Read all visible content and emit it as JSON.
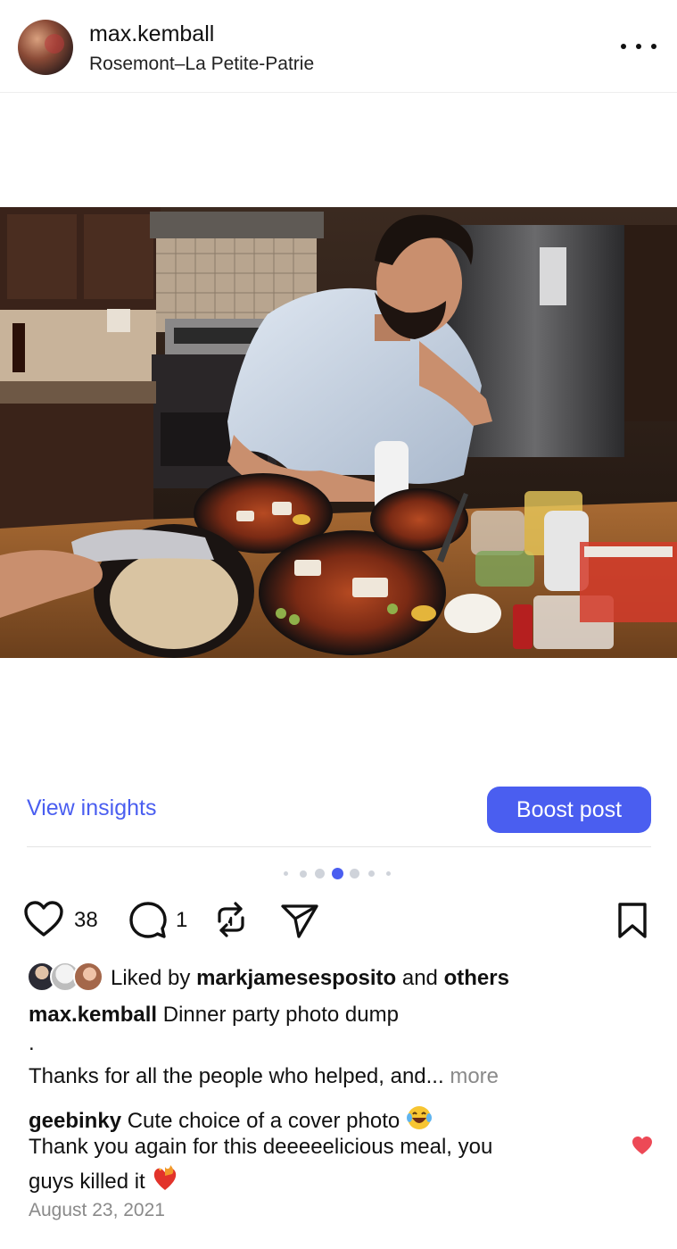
{
  "post": {
    "username": "max.kemball",
    "location": "Rosemont–La Petite-Patrie",
    "date": "August 23, 2021"
  },
  "photo": {
    "alt": "Man drizzling sauce over plates of grilled octopus at a kitchen counter"
  },
  "insights": {
    "view_label": "View insights",
    "boost_label": "Boost post",
    "accent_color": "#4a5ef0"
  },
  "carousel": {
    "total_dots": 6,
    "active_index": 2
  },
  "actions": {
    "likes_count": "38",
    "comments_count": "1",
    "icons": [
      "heart-icon",
      "comment-icon",
      "repost-icon",
      "share-icon",
      "bookmark-icon"
    ]
  },
  "likes": {
    "prefix": "Liked by",
    "user": "markjamesesposito",
    "and": "and",
    "others": "others"
  },
  "caption": {
    "username": "max.kemball",
    "line1": "Dinner party photo dump",
    "dot": ".",
    "line3": "Thanks for all the people who helped, and...",
    "more": "more"
  },
  "comment": {
    "username": "geebinky",
    "text1": "Cute choice of a cover photo",
    "emoji1": "laughing-tears-emoji",
    "text2": "Thank you again for this deeeeelicious meal, you",
    "text3": "guys killed it",
    "emoji2": "heart-on-fire-emoji",
    "like_color": "#ed4956"
  }
}
